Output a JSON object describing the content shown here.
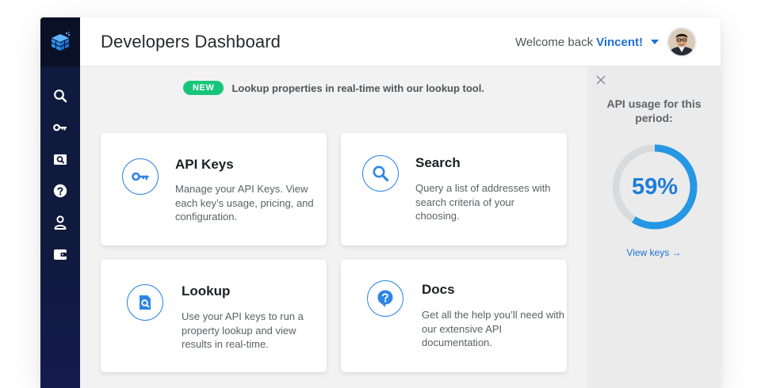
{
  "header": {
    "title": "Developers Dashboard",
    "welcome_prefix": "Welcome back",
    "user_name": "Vincent!"
  },
  "sidebar": {
    "items": [
      {
        "icon": "search-icon"
      },
      {
        "icon": "key-icon"
      },
      {
        "icon": "lookup-icon"
      },
      {
        "icon": "help-icon"
      },
      {
        "icon": "user-icon"
      },
      {
        "icon": "wallet-icon"
      }
    ]
  },
  "banner": {
    "badge": "NEW",
    "text": "Lookup properties in real-time with our lookup tool."
  },
  "cards": [
    {
      "title": "API Keys",
      "description": "Manage your API Keys. View each key’s usage, pricing, and configuration.",
      "icon": "key-icon"
    },
    {
      "title": "Search",
      "description": "Query a list of addresses with search criteria of your choosing.",
      "icon": "search-icon"
    },
    {
      "title": "Lookup",
      "description": "Use your API keys to run a property lookup and view results in real-time.",
      "icon": "lookup-icon"
    },
    {
      "title": "Docs",
      "description": "Get all the help you’ll need with our extensive API documentation.",
      "icon": "docs-icon"
    }
  ],
  "usage_panel": {
    "title": "API usage for this period:",
    "percent_label": "59%",
    "percent_value": 0.59,
    "link_label": "View keys →"
  },
  "colors": {
    "accent": "#1f6fd8",
    "ring_fill": "#2597e4",
    "ring_track": "#d9dadc",
    "badge_green": "#17c57a",
    "sidebar_bg": "#101a3c"
  }
}
